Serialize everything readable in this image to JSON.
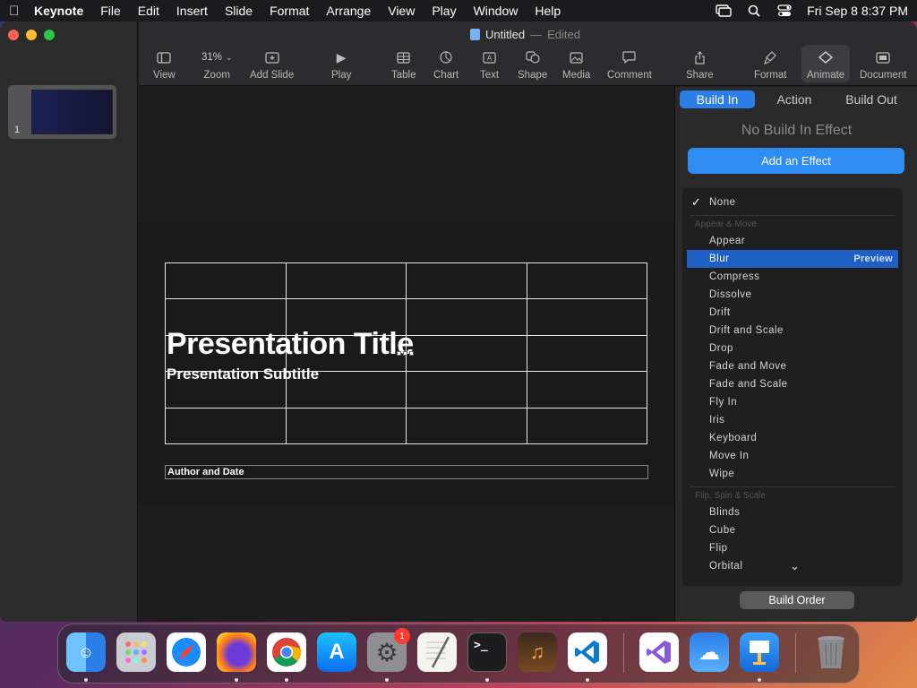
{
  "menubar": {
    "app": "Keynote",
    "items": [
      "File",
      "Edit",
      "Insert",
      "Slide",
      "Format",
      "Arrange",
      "View",
      "Play",
      "Window",
      "Help"
    ],
    "clock": "Fri Sep 8  8:37 PM"
  },
  "document": {
    "title": "Untitled",
    "separator": "—",
    "status": "Edited"
  },
  "toolbar": {
    "view": "View",
    "zoom": "Zoom",
    "zoom_value": "31%",
    "add_slide": "Add Slide",
    "play": "Play",
    "table": "Table",
    "chart": "Chart",
    "text": "Text",
    "shape": "Shape",
    "media": "Media",
    "comment": "Comment",
    "share": "Share",
    "format": "Format",
    "animate": "Animate",
    "document": "Document"
  },
  "navigator": {
    "slide_number": "1"
  },
  "slide": {
    "title": "Presentation Title",
    "subtitle": "Presentation Subtitle",
    "author": "Author and Date"
  },
  "inspector": {
    "tabs": [
      "Build In",
      "Action",
      "Build Out"
    ],
    "status": "No Build In Effect",
    "add_effect": "Add an Effect",
    "none_label": "None",
    "category_1": "Appear & Move",
    "effects_1": [
      "Appear",
      "Blur",
      "Compress",
      "Dissolve",
      "Drift",
      "Drift and Scale",
      "Drop",
      "Fade and Move",
      "Fade and Scale",
      "Fly In",
      "Iris",
      "Keyboard",
      "Move In",
      "Wipe"
    ],
    "selected_effect": "Blur",
    "preview": "Preview",
    "category_2": "Flip, Spin & Scale",
    "effects_2": [
      "Blinds",
      "Cube",
      "Flip",
      "Orbital"
    ],
    "build_order": "Build Order"
  },
  "dock": {
    "apps": [
      "Finder",
      "Launchpad",
      "Safari",
      "Firefox",
      "Chrome",
      "App Store",
      "System Settings",
      "TextEdit",
      "Terminal",
      "GarageBand",
      "VS Code",
      "Visual Studio",
      "Weather",
      "Keynote",
      "Trash"
    ],
    "settings_badge": "1"
  }
}
